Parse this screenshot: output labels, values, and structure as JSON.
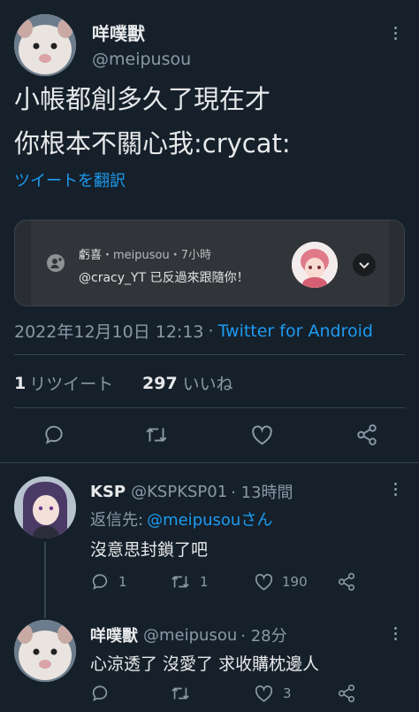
{
  "tweet": {
    "author_name": "咩噗獸",
    "author_handle": "@meipusou",
    "text_line1": "小帳都創多久了現在才",
    "text_line2": "你根本不關心我:crycat:",
    "translate": "ツイートを翻訳",
    "embed": {
      "header_name": "虧喜",
      "header_meta": "・meipusou・7小時",
      "body": "@cracy_YT 已反過來跟隨你！"
    },
    "timestamp": "2022年12月10日 12:13",
    "separator": "·",
    "client": "Twitter for Android",
    "retweet_count": "1",
    "retweet_label": "リツイート",
    "like_count": "297",
    "like_label": "いいね"
  },
  "replies": [
    {
      "name": "KSP",
      "handle": "@KSPKSP01",
      "time": "· 13時間",
      "reply_to_label": "返信先:",
      "reply_to_handle": "@meipusouさん",
      "text": "沒意思封鎖了吧",
      "reply_count": "1",
      "retweet_count": "1",
      "like_count": "190"
    },
    {
      "name": "咩噗獸",
      "handle": "@meipusou",
      "time": "· 28分",
      "text": "心涼透了 沒愛了 求收購枕邊人",
      "like_count": "3"
    }
  ],
  "colors": {
    "background": "#15202b",
    "text": "#e7e9ea",
    "secondary": "#8b98a5",
    "accent": "#1d9bf0",
    "divider": "#38444d"
  }
}
